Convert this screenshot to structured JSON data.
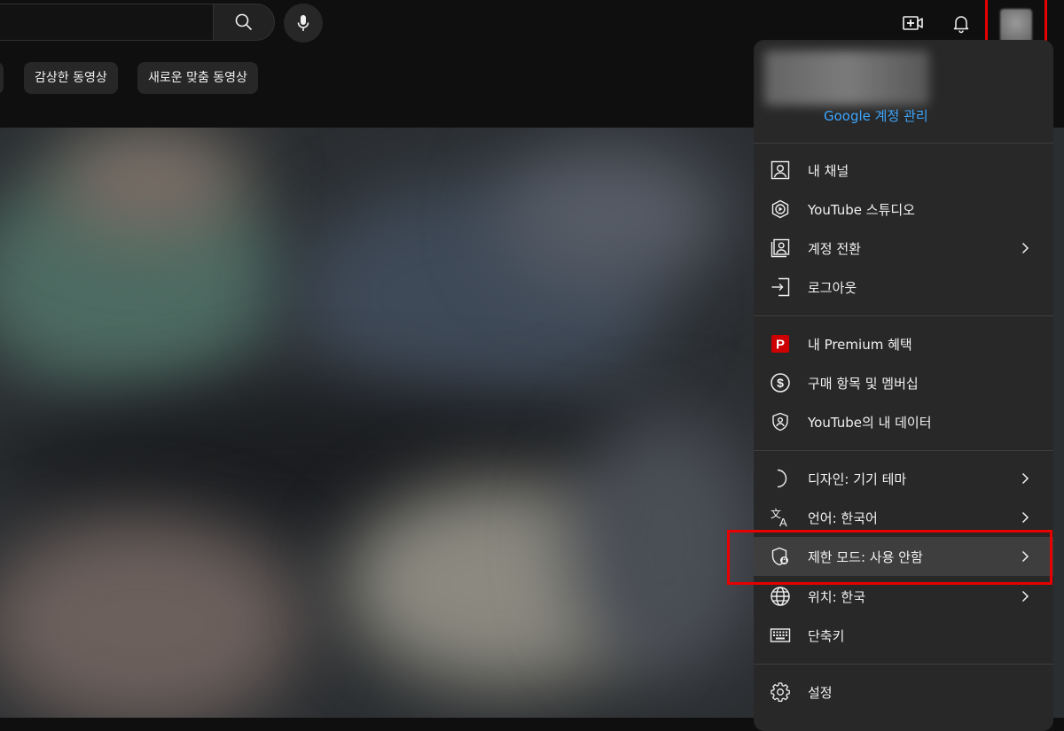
{
  "colors": {
    "background": "#0f0f0f",
    "menu_background": "#282828",
    "link": "#3ea6ff",
    "highlight_red": "#e60000",
    "premium_red": "#cc0000"
  },
  "topbar": {
    "search_placeholder": "",
    "icons": [
      "search-icon",
      "mic-icon",
      "create-video-icon",
      "notifications-bell-icon",
      "avatar"
    ]
  },
  "chips": [
    {
      "label": "감상한 동영상"
    },
    {
      "label": "새로운 맞춤 동영상"
    }
  ],
  "menu": {
    "manage_account": "Google 계정 관리",
    "sections": [
      {
        "items": [
          {
            "label": "내 채널",
            "icon": "person-icon",
            "chevron": false
          },
          {
            "label": "YouTube 스튜디오",
            "icon": "studio-icon",
            "chevron": false
          },
          {
            "label": "계정 전환",
            "icon": "switch-account-icon",
            "chevron": true
          },
          {
            "label": "로그아웃",
            "icon": "sign-out-icon",
            "chevron": false
          }
        ]
      },
      {
        "items": [
          {
            "label": "내 Premium 혜택",
            "icon": "premium-icon",
            "chevron": false
          },
          {
            "label": "구매 항목 및 멤버십",
            "icon": "dollar-icon",
            "chevron": false
          },
          {
            "label": "YouTube의 내 데이터",
            "icon": "data-shield-icon",
            "chevron": false
          }
        ]
      },
      {
        "items": [
          {
            "label": "디자인: 기기 테마",
            "icon": "moon-icon",
            "chevron": true
          },
          {
            "label": "언어: 한국어",
            "icon": "translate-icon",
            "chevron": true
          },
          {
            "label": "제한 모드: 사용 안함",
            "icon": "restricted-shield-icon",
            "chevron": true,
            "highlighted": true
          },
          {
            "label": "위치: 한국",
            "icon": "globe-icon",
            "chevron": true
          },
          {
            "label": "단축키",
            "icon": "keyboard-icon",
            "chevron": false
          }
        ]
      },
      {
        "items": [
          {
            "label": "설정",
            "icon": "gear-icon",
            "chevron": false
          }
        ]
      }
    ]
  }
}
